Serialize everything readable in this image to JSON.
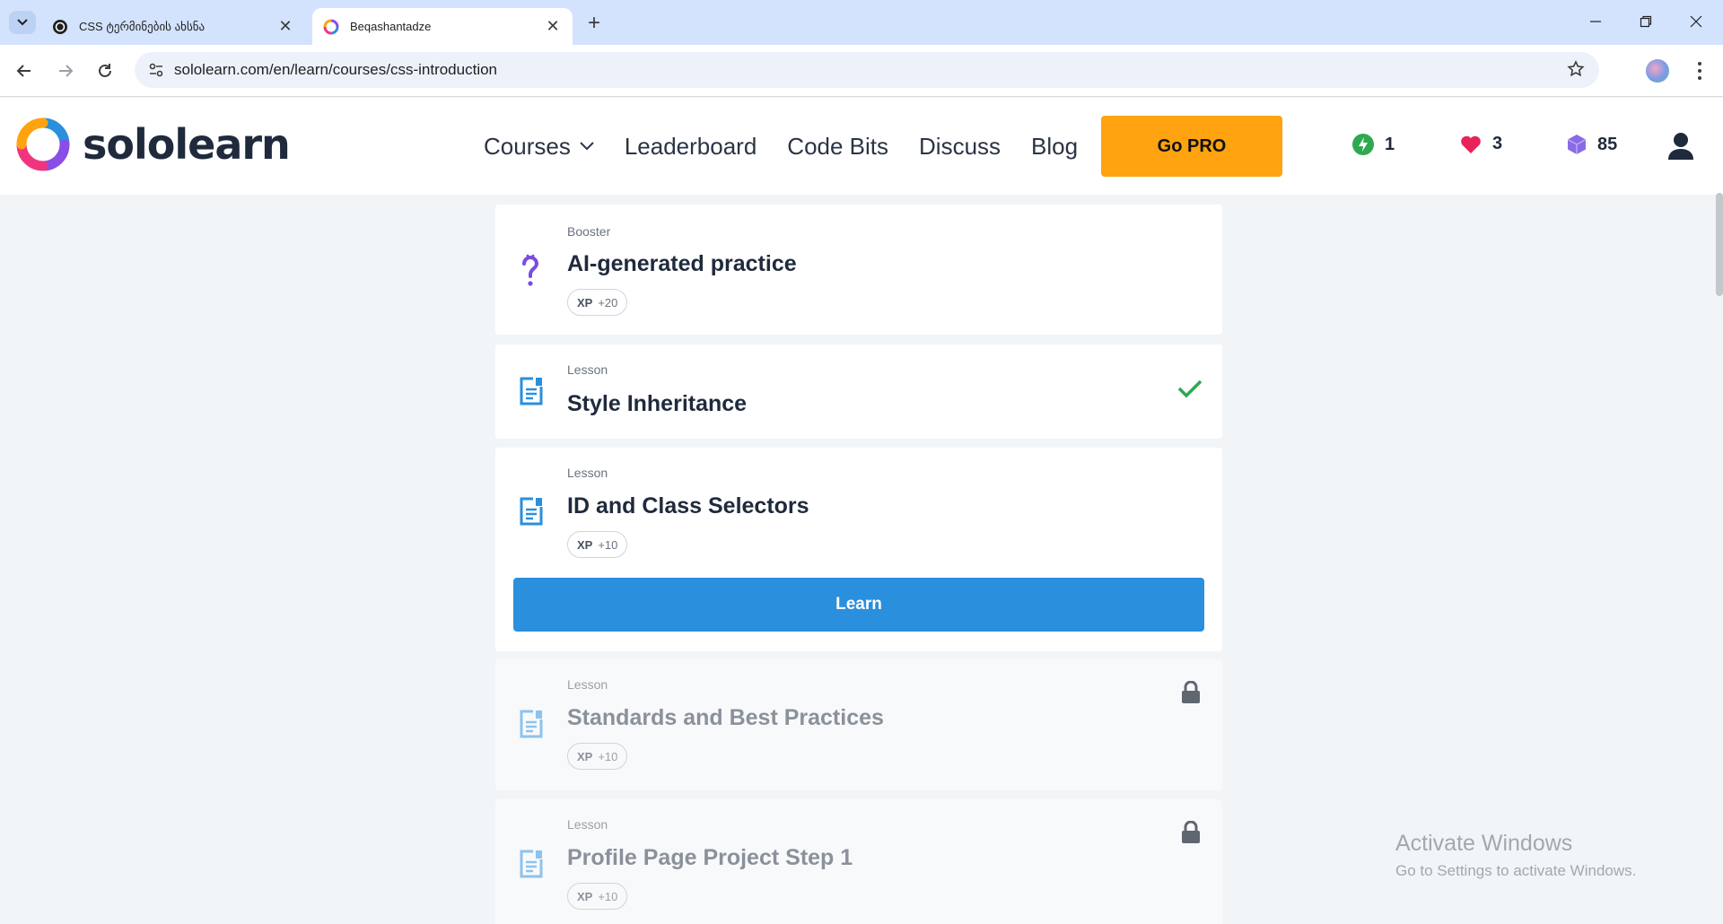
{
  "browser": {
    "tabs": [
      {
        "title": "CSS ტერმინების ახსნა",
        "active": false
      },
      {
        "title": "Beqashantadze",
        "active": true
      }
    ],
    "url": "sololearn.com/en/learn/courses/css-introduction"
  },
  "site": {
    "logo_text": "sololearn",
    "nav": [
      {
        "label": "Courses",
        "has_dropdown": true
      },
      {
        "label": "Leaderboard"
      },
      {
        "label": "Code Bits"
      },
      {
        "label": "Discuss"
      },
      {
        "label": "Blog"
      }
    ],
    "gopro_label": "Go PRO",
    "stats": {
      "streak": "1",
      "hearts": "3",
      "bits": "85"
    },
    "colors": {
      "accent": "#ffa310",
      "primary": "#2a8fdd",
      "success": "#2fa84f"
    }
  },
  "cards": [
    {
      "type": "Booster",
      "title": "AI-generated practice",
      "xp_label": "XP",
      "xp": "+20",
      "icon": "question-icon",
      "state": "available"
    },
    {
      "type": "Lesson",
      "title": "Style Inheritance",
      "icon": "lesson-icon",
      "state": "completed"
    },
    {
      "type": "Lesson",
      "title": "ID and Class Selectors",
      "xp_label": "XP",
      "xp": "+10",
      "icon": "lesson-icon",
      "state": "current",
      "button": "Learn"
    },
    {
      "type": "Lesson",
      "title": "Standards and Best Practices",
      "xp_label": "XP",
      "xp": "+10",
      "icon": "lesson-icon",
      "state": "locked"
    },
    {
      "type": "Lesson",
      "title": "Profile Page Project Step 1",
      "xp_label": "XP",
      "xp": "+10",
      "icon": "lesson-icon",
      "state": "locked"
    }
  ],
  "watermark": {
    "line1": "Activate Windows",
    "line2": "Go to Settings to activate Windows."
  }
}
